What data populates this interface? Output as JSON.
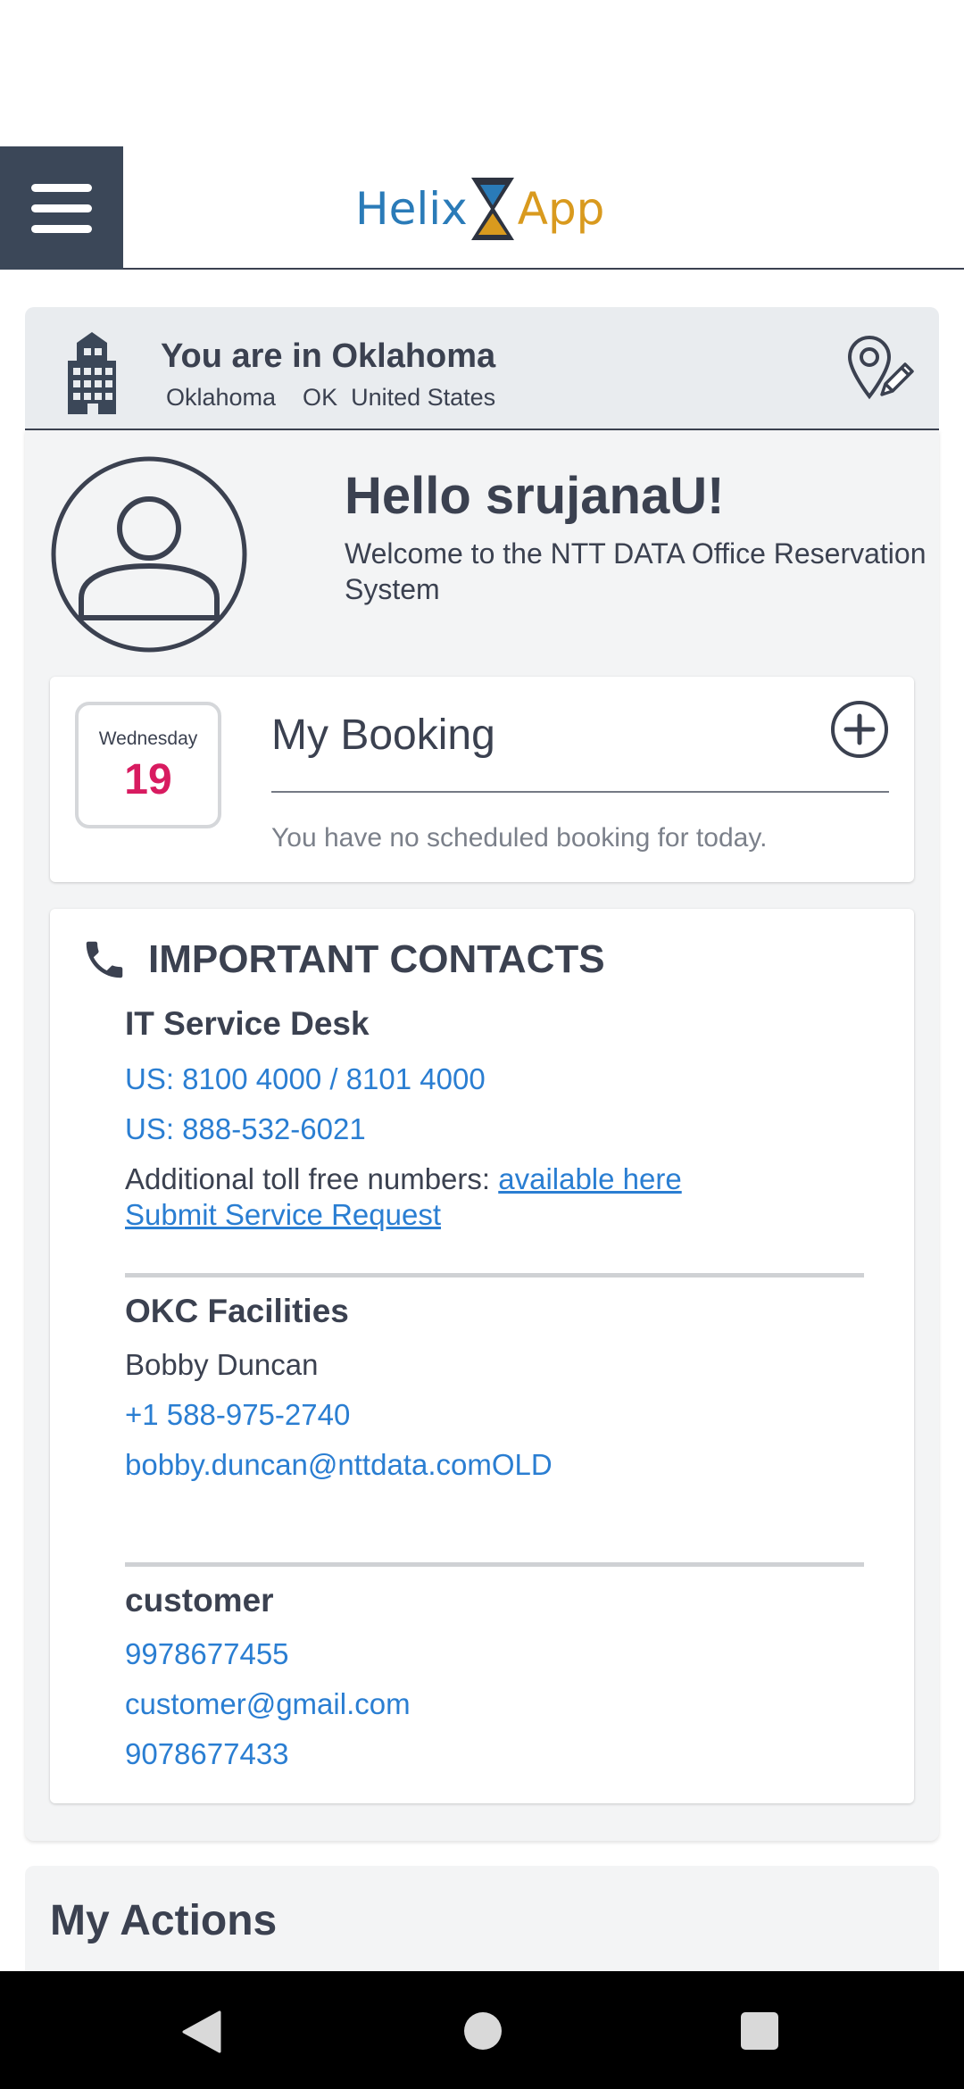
{
  "header": {
    "logo_helix": "Helix",
    "logo_app": "App",
    "menu_icon": "hamburger-menu-icon"
  },
  "location": {
    "title": "You are in Oklahoma",
    "subtitle": "Oklahoma    OK  United States",
    "building_icon": "building-icon",
    "edit_icon": "location-edit-icon"
  },
  "greeting": {
    "hello": "Hello srujanaU!",
    "welcome": "Welcome to the NTT DATA Office Reservation System",
    "avatar_icon": "user-avatar-icon"
  },
  "booking": {
    "day_name": "Wednesday",
    "day_number": "19",
    "title": "My Booking",
    "empty_text": "You have no scheduled booking for today.",
    "add_icon": "add-circle-icon"
  },
  "contacts": {
    "title": "IMPORTANT CONTACTS",
    "phone_icon": "phone-icon",
    "it_desk": {
      "title": "IT Service Desk",
      "phone1": "US: 8100 4000 / 8101 4000",
      "phone2": "US: 888-532-6021",
      "toll_free_label": "Additional toll free numbers:",
      "toll_free_link": "available here",
      "service_request": "Submit Service Request"
    },
    "facilities": {
      "title": "OKC Facilities",
      "name": "Bobby Duncan",
      "phone": "+1 588-975-2740",
      "email": "bobby.duncan@nttdata.comOLD"
    },
    "customer": {
      "title": "customer",
      "phone1": "9978677455",
      "email": "customer@gmail.com",
      "phone2": "9078677433"
    }
  },
  "actions": {
    "title": "My Actions"
  },
  "colors": {
    "primary_dark": "#3b4758",
    "link": "#2a7ed2",
    "date_accent": "#d81b60",
    "logo_blue": "#2a7bb8",
    "logo_gold": "#d99a1e"
  }
}
